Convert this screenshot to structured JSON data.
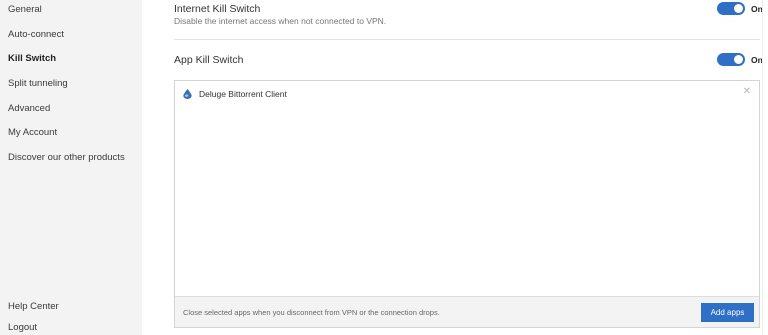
{
  "sidebar": {
    "items": [
      {
        "label": "General"
      },
      {
        "label": "Auto-connect"
      },
      {
        "label": "Kill Switch"
      },
      {
        "label": "Split tunneling"
      },
      {
        "label": "Advanced"
      },
      {
        "label": "My Account"
      },
      {
        "label": "Discover our other products"
      }
    ],
    "bottom": [
      {
        "label": "Help Center"
      },
      {
        "label": "Logout"
      }
    ]
  },
  "internet_kill_switch": {
    "title": "Internet Kill Switch",
    "description": "Disable the internet access when not connected to VPN.",
    "toggle_label": "On",
    "enabled": true
  },
  "app_kill_switch": {
    "title": "App Kill Switch",
    "toggle_label": "On",
    "enabled": true,
    "apps": [
      {
        "name": "Deluge Bittorrent Client",
        "icon": "deluge-drop-icon",
        "close_icon": "close-icon"
      }
    ],
    "footer_text": "Close selected apps when you disconnect from VPN or the connection drops.",
    "add_button_label": "Add apps"
  },
  "colors": {
    "accent": "#2f6fc6",
    "sidebar_bg": "#f3f3f3",
    "footer_bg": "#f3f3f3"
  }
}
